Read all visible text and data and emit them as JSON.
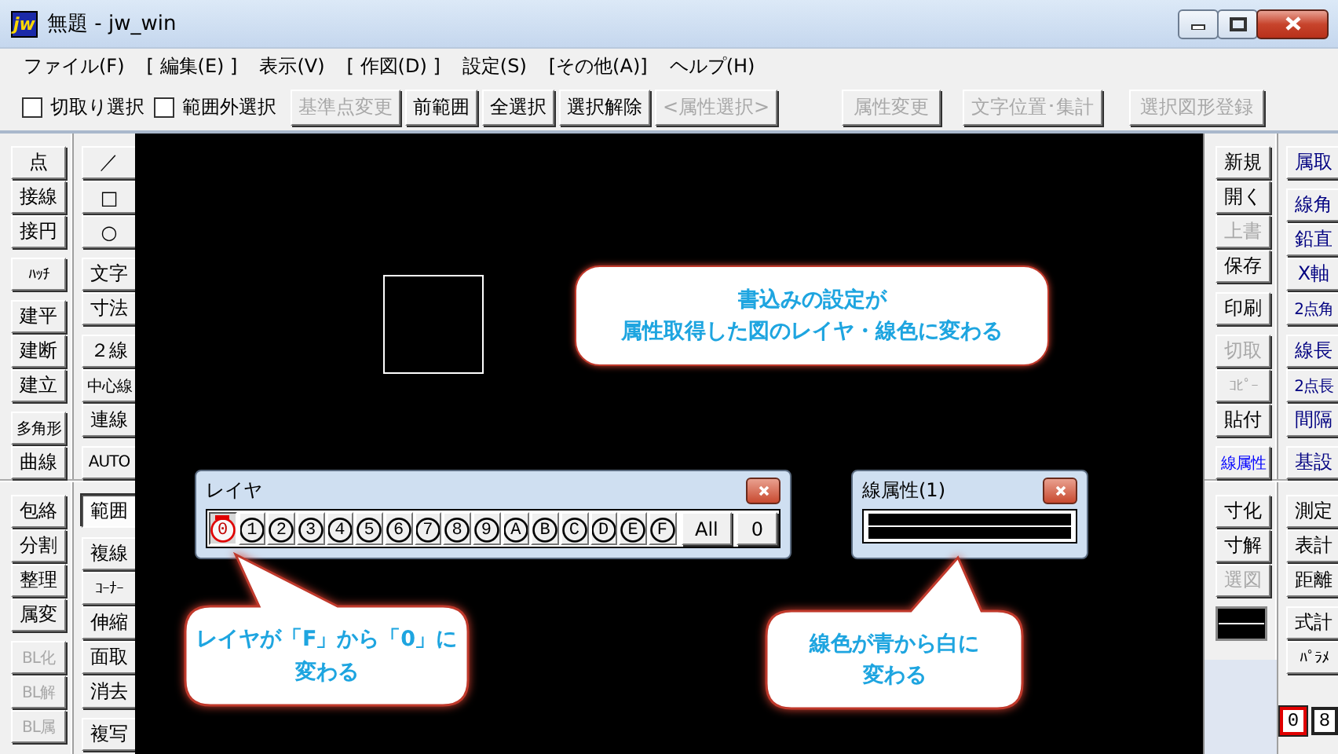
{
  "window": {
    "app_icon": "jw",
    "title": "無題 - jw_win"
  },
  "menu": [
    "ファイル(F)",
    "[ 編集(E) ]",
    "表示(V)",
    "[ 作図(D) ]",
    "設定(S)",
    "[その他(A)]",
    "ヘルプ(H)"
  ],
  "toolbar": {
    "checkboxes": [
      {
        "label": "切取り選択",
        "checked": false
      },
      {
        "label": "範囲外選択",
        "checked": false
      }
    ],
    "button_groups": [
      [
        {
          "label": "基準点変更",
          "disabled": true
        },
        {
          "label": "前範囲",
          "disabled": false
        },
        {
          "label": "全選択",
          "disabled": false
        },
        {
          "label": "選択解除",
          "disabled": false
        },
        {
          "label": "<属性選択>",
          "disabled": true
        }
      ],
      [
        {
          "label": "属性変更",
          "disabled": true
        }
      ],
      [
        {
          "label": "文字位置･集計",
          "disabled": true
        }
      ],
      [
        {
          "label": "選択図形登録",
          "disabled": true
        }
      ]
    ]
  },
  "left_toolbar": {
    "sections": [
      {
        "columns": [
          {
            "groups": [
              [
                {
                  "label": "点",
                  "disabled": false,
                  "pressed": false
                },
                {
                  "label": "接線",
                  "disabled": false,
                  "pressed": false
                },
                {
                  "label": "接円",
                  "disabled": false,
                  "pressed": false
                }
              ],
              [
                {
                  "label": "ﾊｯﾁ",
                  "disabled": false,
                  "pressed": false
                }
              ],
              [
                {
                  "label": "建平",
                  "disabled": false,
                  "pressed": false
                },
                {
                  "label": "建断",
                  "disabled": false,
                  "pressed": false
                },
                {
                  "label": "建立",
                  "disabled": false,
                  "pressed": false
                }
              ],
              [
                {
                  "label": "多角形",
                  "disabled": false,
                  "pressed": false
                },
                {
                  "label": "曲線",
                  "disabled": false,
                  "pressed": false
                }
              ]
            ]
          },
          {
            "groups": [
              [
                {
                  "label": "／",
                  "disabled": false,
                  "pressed": false
                },
                {
                  "label": "□",
                  "disabled": false,
                  "pressed": false
                },
                {
                  "label": "○",
                  "disabled": false,
                  "pressed": false
                }
              ],
              [
                {
                  "label": "文字",
                  "disabled": false,
                  "pressed": false
                },
                {
                  "label": "寸法",
                  "disabled": false,
                  "pressed": false
                }
              ],
              [
                {
                  "label": "２線",
                  "disabled": false,
                  "pressed": false
                },
                {
                  "label": "中心線",
                  "disabled": false,
                  "pressed": false
                },
                {
                  "label": "連線",
                  "disabled": false,
                  "pressed": false
                }
              ],
              [
                {
                  "label": "AUTO",
                  "disabled": false,
                  "pressed": false
                }
              ]
            ]
          }
        ]
      },
      {
        "columns": [
          {
            "groups": [
              [
                {
                  "label": "包絡",
                  "disabled": false,
                  "pressed": false
                },
                {
                  "label": "分割",
                  "disabled": false,
                  "pressed": false
                },
                {
                  "label": "整理",
                  "disabled": false,
                  "pressed": false
                },
                {
                  "label": "属変",
                  "disabled": false,
                  "pressed": false
                }
              ],
              [
                {
                  "label": "BL化",
                  "disabled": true,
                  "pressed": false
                },
                {
                  "label": "BL解",
                  "disabled": true,
                  "pressed": false
                },
                {
                  "label": "BL属",
                  "disabled": true,
                  "pressed": false
                }
              ]
            ]
          },
          {
            "groups": [
              [
                {
                  "label": "範囲",
                  "disabled": false,
                  "pressed": true
                }
              ],
              [
                {
                  "label": "複線",
                  "disabled": false,
                  "pressed": false
                },
                {
                  "label": "ｺｰﾅｰ",
                  "disabled": false,
                  "pressed": false
                },
                {
                  "label": "伸縮",
                  "disabled": false,
                  "pressed": false
                },
                {
                  "label": "面取",
                  "disabled": false,
                  "pressed": false
                },
                {
                  "label": "消去",
                  "disabled": false,
                  "pressed": false
                }
              ],
              [
                {
                  "label": "複写",
                  "disabled": false,
                  "pressed": false
                }
              ]
            ]
          }
        ]
      }
    ]
  },
  "right_toolbar": {
    "sections": [
      {
        "columns": [
          {
            "groups": [
              [
                {
                  "label": "新規",
                  "disabled": false
                },
                {
                  "label": "開く",
                  "disabled": false
                },
                {
                  "label": "上書",
                  "disabled": true
                },
                {
                  "label": "保存",
                  "disabled": false
                }
              ],
              [
                {
                  "label": "印刷",
                  "disabled": false
                }
              ],
              [
                {
                  "label": "切取",
                  "disabled": true
                },
                {
                  "label": "ｺﾋﾟｰ",
                  "disabled": true
                },
                {
                  "label": "貼付",
                  "disabled": false
                }
              ],
              [
                {
                  "label": "線属性",
                  "disabled": false,
                  "color": "#0000ff"
                }
              ]
            ]
          },
          {
            "groups": [
              [
                {
                  "label": "属取",
                  "disabled": false,
                  "color": "#000080"
                }
              ],
              [
                {
                  "label": "線角",
                  "disabled": false,
                  "color": "#000080"
                },
                {
                  "label": "鉛直",
                  "disabled": false,
                  "color": "#000080"
                },
                {
                  "label": "X軸",
                  "disabled": false,
                  "color": "#000080"
                },
                {
                  "label": "2点角",
                  "disabled": false,
                  "color": "#000080"
                }
              ],
              [
                {
                  "label": "線長",
                  "disabled": false,
                  "color": "#000080"
                },
                {
                  "label": "2点長",
                  "disabled": false,
                  "color": "#000080"
                },
                {
                  "label": "間隔",
                  "disabled": false,
                  "color": "#000080"
                }
              ],
              [
                {
                  "label": "基設",
                  "disabled": false,
                  "color": "#000080"
                }
              ]
            ]
          }
        ]
      },
      {
        "columns": [
          {
            "groups": [
              [
                {
                  "label": "寸化",
                  "disabled": false
                },
                {
                  "label": "寸解",
                  "disabled": false
                },
                {
                  "label": "選図",
                  "disabled": true
                }
              ]
            ]
          },
          {
            "groups": [
              [
                {
                  "label": "測定",
                  "disabled": false
                },
                {
                  "label": "表計",
                  "disabled": false
                },
                {
                  "label": "距離",
                  "disabled": false
                }
              ],
              [
                {
                  "label": "式計",
                  "disabled": false
                },
                {
                  "label": "ﾊﾟﾗﾒ",
                  "disabled": false
                }
              ]
            ]
          }
        ]
      }
    ],
    "layer_groups": [
      {
        "label": "0",
        "selected": true
      },
      {
        "label": "8",
        "selected": false
      }
    ]
  },
  "layer_dialog": {
    "title": "レイヤ",
    "layers": [
      {
        "label": "0",
        "selected": true
      },
      {
        "label": "1",
        "selected": false
      },
      {
        "label": "2",
        "selected": false
      },
      {
        "label": "3",
        "selected": false
      },
      {
        "label": "4",
        "selected": false
      },
      {
        "label": "5",
        "selected": false
      },
      {
        "label": "6",
        "selected": false
      },
      {
        "label": "7",
        "selected": false
      },
      {
        "label": "8",
        "selected": false
      },
      {
        "label": "9",
        "selected": false
      },
      {
        "label": "A",
        "selected": false
      },
      {
        "label": "B",
        "selected": false
      },
      {
        "label": "C",
        "selected": false
      },
      {
        "label": "D",
        "selected": false
      },
      {
        "label": "E",
        "selected": false
      },
      {
        "label": "F",
        "selected": false
      }
    ],
    "buttons": [
      "All",
      "0"
    ]
  },
  "line_dialog": {
    "title": "線属性(1)"
  },
  "callouts": [
    {
      "lines": [
        "書込みの設定が",
        "属性取得した図のレイヤ・線色に変わる"
      ]
    },
    {
      "lines": [
        "レイヤが「F」から「0」に",
        "変わる"
      ]
    },
    {
      "lines": [
        "線色が青から白に",
        "変わる"
      ]
    }
  ]
}
